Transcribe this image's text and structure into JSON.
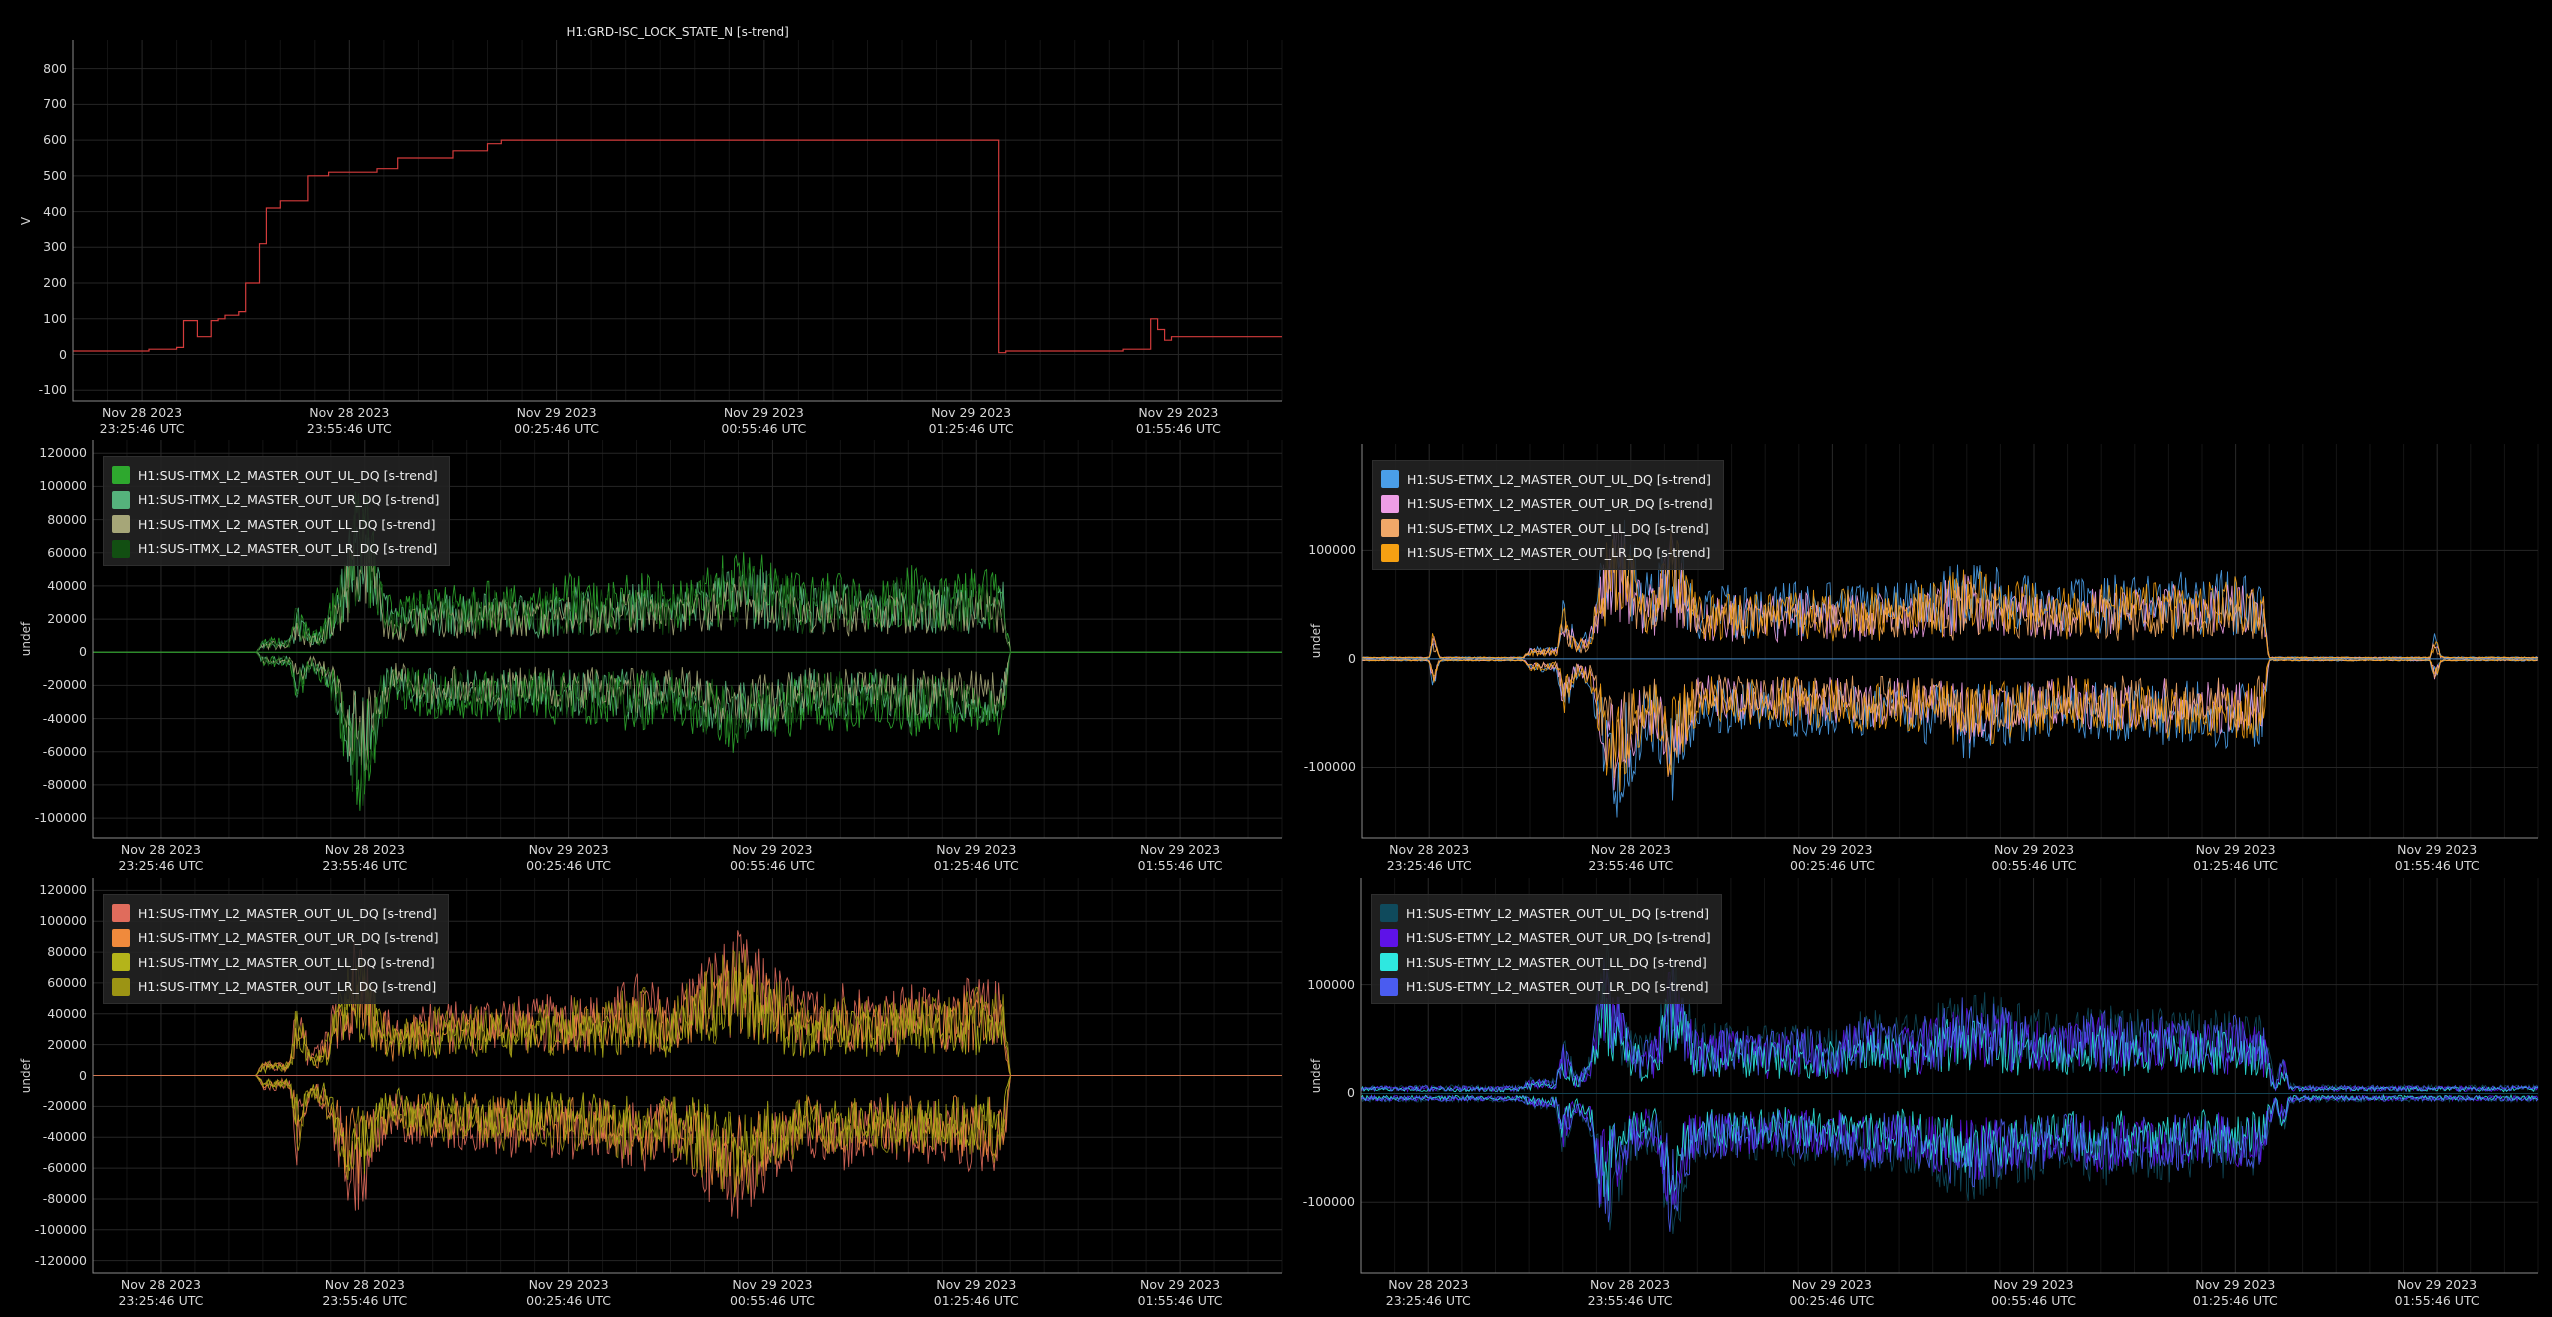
{
  "colors": {
    "background": "#000000",
    "grid": "#262626",
    "axis": "#8a8a8a"
  },
  "chart_data": [
    {
      "id": "lock",
      "type": "line",
      "title": "H1:GRD-ISC_LOCK_STATE_N [s-trend]",
      "ylabel": "V",
      "ylim": [
        -130,
        880
      ],
      "yticks": [
        -100,
        0,
        100,
        200,
        300,
        400,
        500,
        600,
        700,
        800
      ],
      "xlim": [
        -10,
        165
      ],
      "xticks": [
        {
          "v": 0,
          "date": "Nov 28 2023",
          "time": "23:25:46 UTC"
        },
        {
          "v": 30,
          "date": "Nov 28 2023",
          "time": "23:55:46 UTC"
        },
        {
          "v": 60,
          "date": "Nov 29 2023",
          "time": "00:25:46 UTC"
        },
        {
          "v": 90,
          "date": "Nov 29 2023",
          "time": "00:55:46 UTC"
        },
        {
          "v": 120,
          "date": "Nov 29 2023",
          "time": "01:25:46 UTC"
        },
        {
          "v": 150,
          "date": "Nov 29 2023",
          "time": "01:55:46 UTC"
        }
      ],
      "series": [
        {
          "color": "#d23b3b",
          "x": [
            -10,
            1,
            1,
            5,
            5,
            6,
            6,
            8,
            8,
            10,
            10,
            11,
            11,
            12,
            12,
            14,
            14,
            15,
            15,
            17,
            17,
            18,
            18,
            20,
            20,
            22,
            22,
            24,
            24,
            27,
            27,
            34,
            34,
            37,
            37,
            45,
            45,
            50,
            50,
            52,
            52,
            53,
            53,
            124,
            124,
            125,
            125,
            142,
            142,
            146,
            146,
            147,
            147,
            148,
            148,
            149,
            149,
            165
          ],
          "y": [
            10,
            10,
            15,
            15,
            20,
            20,
            95,
            95,
            50,
            50,
            95,
            95,
            100,
            100,
            110,
            110,
            120,
            120,
            200,
            200,
            310,
            310,
            410,
            410,
            430,
            430,
            430,
            430,
            500,
            500,
            510,
            510,
            520,
            520,
            550,
            550,
            570,
            570,
            590,
            590,
            600,
            600,
            600,
            600,
            5,
            5,
            10,
            10,
            15,
            15,
            100,
            100,
            70,
            70,
            40,
            40,
            50,
            50
          ]
        }
      ],
      "legend": []
    },
    {
      "id": "itmx",
      "type": "line",
      "title": "",
      "ylabel": "undef",
      "ylim": [
        -112000,
        128000
      ],
      "yticks": [
        -100000,
        -80000,
        -60000,
        -40000,
        -20000,
        0,
        20000,
        40000,
        60000,
        80000,
        100000,
        120000
      ],
      "xlim": [
        -10,
        165
      ],
      "xticks": [
        {
          "v": 0,
          "date": "Nov 28 2023",
          "time": "23:25:46 UTC"
        },
        {
          "v": 30,
          "date": "Nov 28 2023",
          "time": "23:55:46 UTC"
        },
        {
          "v": 60,
          "date": "Nov 29 2023",
          "time": "00:25:46 UTC"
        },
        {
          "v": 90,
          "date": "Nov 29 2023",
          "time": "00:55:46 UTC"
        },
        {
          "v": 120,
          "date": "Nov 29 2023",
          "time": "01:25:46 UTC"
        },
        {
          "v": 150,
          "date": "Nov 29 2023",
          "time": "01:55:46 UTC"
        }
      ],
      "legend": [
        {
          "name": "H1:SUS-ITMX_L2_MASTER_OUT_UL_DQ [s-trend]",
          "color": "#2ea82e"
        },
        {
          "name": "H1:SUS-ITMX_L2_MASTER_OUT_UR_DQ [s-trend]",
          "color": "#55b27c"
        },
        {
          "name": "H1:SUS-ITMX_L2_MASTER_OUT_LL_DQ [s-trend]",
          "color": "#a6a678"
        },
        {
          "name": "H1:SUS-ITMX_L2_MASTER_OUT_LR_DQ [s-trend]",
          "color": "#124f12"
        }
      ],
      "envelope": {
        "x": [
          -10,
          14,
          15,
          19,
          20,
          22,
          24,
          26,
          28,
          30,
          32,
          34,
          36,
          40,
          45,
          50,
          55,
          60,
          65,
          70,
          75,
          80,
          85,
          90,
          95,
          100,
          105,
          110,
          115,
          120,
          124,
          125,
          165
        ],
        "amp": [
          0,
          0,
          9000,
          9000,
          35000,
          12000,
          20000,
          45000,
          95000,
          105000,
          60000,
          30000,
          35000,
          42000,
          40000,
          45000,
          38000,
          48000,
          42000,
          50000,
          40000,
          55000,
          62000,
          58000,
          45000,
          50000,
          42000,
          55000,
          48000,
          52000,
          50000,
          0,
          0
        ]
      }
    },
    {
      "id": "itmy",
      "type": "line",
      "title": "",
      "ylabel": "undef",
      "ylim": [
        -128000,
        128000
      ],
      "yticks": [
        -120000,
        -100000,
        -80000,
        -60000,
        -40000,
        -20000,
        0,
        20000,
        40000,
        60000,
        80000,
        100000,
        120000
      ],
      "xlim": [
        -10,
        165
      ],
      "xticks": [
        {
          "v": 0,
          "date": "Nov 28 2023",
          "time": "23:25:46 UTC"
        },
        {
          "v": 30,
          "date": "Nov 28 2023",
          "time": "23:55:46 UTC"
        },
        {
          "v": 60,
          "date": "Nov 29 2023",
          "time": "00:25:46 UTC"
        },
        {
          "v": 90,
          "date": "Nov 29 2023",
          "time": "00:55:46 UTC"
        },
        {
          "v": 120,
          "date": "Nov 29 2023",
          "time": "01:25:46 UTC"
        },
        {
          "v": 150,
          "date": "Nov 29 2023",
          "time": "01:55:46 UTC"
        }
      ],
      "legend": [
        {
          "name": "H1:SUS-ITMY_L2_MASTER_OUT_UL_DQ [s-trend]",
          "color": "#e06c5c"
        },
        {
          "name": "H1:SUS-ITMY_L2_MASTER_OUT_UR_DQ [s-trend]",
          "color": "#f08a3c"
        },
        {
          "name": "H1:SUS-ITMY_L2_MASTER_OUT_LL_DQ [s-trend]",
          "color": "#b4b41a"
        },
        {
          "name": "H1:SUS-ITMY_L2_MASTER_OUT_LR_DQ [s-trend]",
          "color": "#9c9414"
        }
      ],
      "envelope": {
        "x": [
          -10,
          14,
          15,
          19,
          20,
          22,
          24,
          26,
          28,
          30,
          32,
          34,
          36,
          40,
          45,
          50,
          55,
          60,
          65,
          70,
          75,
          80,
          85,
          90,
          95,
          100,
          105,
          110,
          115,
          120,
          124,
          125,
          165
        ],
        "amp": [
          0,
          0,
          10000,
          10000,
          60000,
          15000,
          25000,
          60000,
          90000,
          85000,
          55000,
          40000,
          45000,
          50000,
          48000,
          55000,
          50000,
          58000,
          52000,
          68000,
          55000,
          80000,
          95000,
          75000,
          55000,
          65000,
          55000,
          60000,
          58000,
          65000,
          62000,
          0,
          0
        ]
      }
    },
    {
      "id": "etmx",
      "type": "line",
      "title": "",
      "ylabel": "undef",
      "ylim": [
        -165000,
        198000
      ],
      "yticks": [
        -100000,
        0,
        100000
      ],
      "xlim": [
        -10,
        165
      ],
      "xticks": [
        {
          "v": 0,
          "date": "Nov 28 2023",
          "time": "23:25:46 UTC"
        },
        {
          "v": 30,
          "date": "Nov 28 2023",
          "time": "23:55:46 UTC"
        },
        {
          "v": 60,
          "date": "Nov 29 2023",
          "time": "00:25:46 UTC"
        },
        {
          "v": 90,
          "date": "Nov 29 2023",
          "time": "00:55:46 UTC"
        },
        {
          "v": 120,
          "date": "Nov 29 2023",
          "time": "01:25:46 UTC"
        },
        {
          "v": 150,
          "date": "Nov 29 2023",
          "time": "01:55:46 UTC"
        }
      ],
      "legend": [
        {
          "name": "H1:SUS-ETMX_L2_MASTER_OUT_UL_DQ [s-trend]",
          "color": "#4a9ee8"
        },
        {
          "name": "H1:SUS-ETMX_L2_MASTER_OUT_UR_DQ [s-trend]",
          "color": "#ee9ee6"
        },
        {
          "name": "H1:SUS-ETMX_L2_MASTER_OUT_LL_DQ [s-trend]",
          "color": "#f0a868"
        },
        {
          "name": "H1:SUS-ETMX_L2_MASTER_OUT_LR_DQ [s-trend]",
          "color": "#f5a012"
        }
      ],
      "envelope": {
        "x": [
          -10,
          0,
          0.5,
          1,
          1.5,
          2,
          14,
          15,
          19,
          20,
          22,
          24,
          26,
          28,
          30,
          32,
          34,
          36,
          40,
          45,
          50,
          55,
          60,
          65,
          70,
          75,
          80,
          85,
          90,
          95,
          100,
          105,
          110,
          115,
          120,
          124,
          125,
          149,
          149.5,
          150,
          150.5,
          151,
          165
        ],
        "amp": [
          2000,
          2000,
          28000,
          20000,
          3000,
          2000,
          2000,
          12000,
          12000,
          60000,
          18000,
          30000,
          110000,
          160000,
          120000,
          80000,
          90000,
          140000,
          65000,
          70000,
          68000,
          72000,
          70000,
          75000,
          72000,
          80000,
          95000,
          85000,
          78000,
          72000,
          80000,
          75000,
          82000,
          78000,
          85000,
          80000,
          2000,
          2000,
          25000,
          18000,
          4000,
          2000,
          2000
        ]
      }
    },
    {
      "id": "etmy",
      "type": "line",
      "title": "",
      "ylabel": "undef",
      "ylim": [
        -165000,
        198000
      ],
      "yticks": [
        -100000,
        0,
        100000
      ],
      "xlim": [
        -10,
        165
      ],
      "xticks": [
        {
          "v": 0,
          "date": "Nov 28 2023",
          "time": "23:25:46 UTC"
        },
        {
          "v": 30,
          "date": "Nov 28 2023",
          "time": "23:55:46 UTC"
        },
        {
          "v": 60,
          "date": "Nov 29 2023",
          "time": "00:25:46 UTC"
        },
        {
          "v": 90,
          "date": "Nov 29 2023",
          "time": "00:55:46 UTC"
        },
        {
          "v": 120,
          "date": "Nov 29 2023",
          "time": "01:25:46 UTC"
        },
        {
          "v": 150,
          "date": "Nov 29 2023",
          "time": "01:55:46 UTC"
        }
      ],
      "legend": [
        {
          "name": "H1:SUS-ETMY_L2_MASTER_OUT_UL_DQ [s-trend]",
          "color": "#0f4a5c"
        },
        {
          "name": "H1:SUS-ETMY_L2_MASTER_OUT_UR_DQ [s-trend]",
          "color": "#5e12e8"
        },
        {
          "name": "H1:SUS-ETMY_L2_MASTER_OUT_LL_DQ [s-trend]",
          "color": "#2ee8e0"
        },
        {
          "name": "H1:SUS-ETMY_L2_MASTER_OUT_LR_DQ [s-trend]",
          "color": "#4a5cf0"
        }
      ],
      "envelope": {
        "x": [
          -10,
          0,
          14,
          15,
          19,
          20,
          22,
          24,
          26,
          28,
          30,
          32,
          34,
          36,
          40,
          45,
          50,
          55,
          60,
          65,
          70,
          75,
          80,
          85,
          90,
          95,
          100,
          105,
          110,
          115,
          120,
          124,
          126,
          127,
          128,
          130,
          165
        ],
        "amp": [
          8000,
          8000,
          8000,
          15000,
          15000,
          60000,
          20000,
          35000,
          150000,
          110000,
          70000,
          55000,
          60000,
          150000,
          65000,
          70000,
          62000,
          68000,
          65000,
          80000,
          70000,
          85000,
          100000,
          90000,
          80000,
          72000,
          88000,
          78000,
          82000,
          75000,
          80000,
          75000,
          8000,
          50000,
          10000,
          8000,
          8000
        ]
      }
    }
  ]
}
